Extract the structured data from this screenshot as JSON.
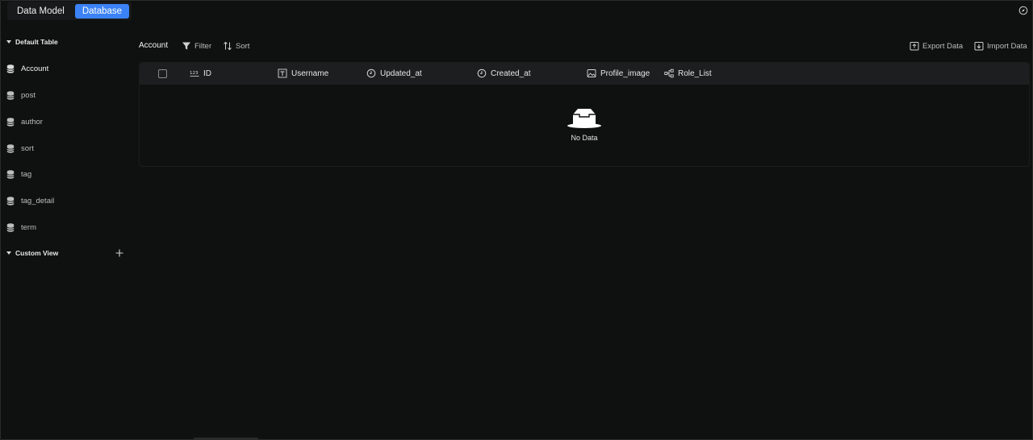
{
  "tabs": [
    {
      "label": "Data Model",
      "active": false
    },
    {
      "label": "Database",
      "active": true
    }
  ],
  "sidebar": {
    "default_section": "Default Table",
    "tables": [
      {
        "label": "Account",
        "active": true
      },
      {
        "label": "post"
      },
      {
        "label": "author"
      },
      {
        "label": "sort"
      },
      {
        "label": "tag"
      },
      {
        "label": "tag_detail"
      },
      {
        "label": "term"
      }
    ],
    "custom_section": "Custom View"
  },
  "toolbar": {
    "title": "Account",
    "filter_label": "Filter",
    "sort_label": "Sort",
    "export_label": "Export Data",
    "import_label": "Import Data"
  },
  "table": {
    "columns": [
      {
        "label": "ID",
        "icon": "number-icon"
      },
      {
        "label": "Username",
        "icon": "text-field-icon"
      },
      {
        "label": "Updated_at",
        "icon": "clock-icon"
      },
      {
        "label": "Created_at",
        "icon": "clock-icon"
      },
      {
        "label": "Profile_image",
        "icon": "image-icon"
      },
      {
        "label": "Role_List",
        "icon": "relation-icon"
      }
    ],
    "empty_text": "No Data"
  },
  "colors": {
    "accent": "#3b82f6",
    "background": "#0f1010",
    "header_row": "#1d1e1f"
  }
}
